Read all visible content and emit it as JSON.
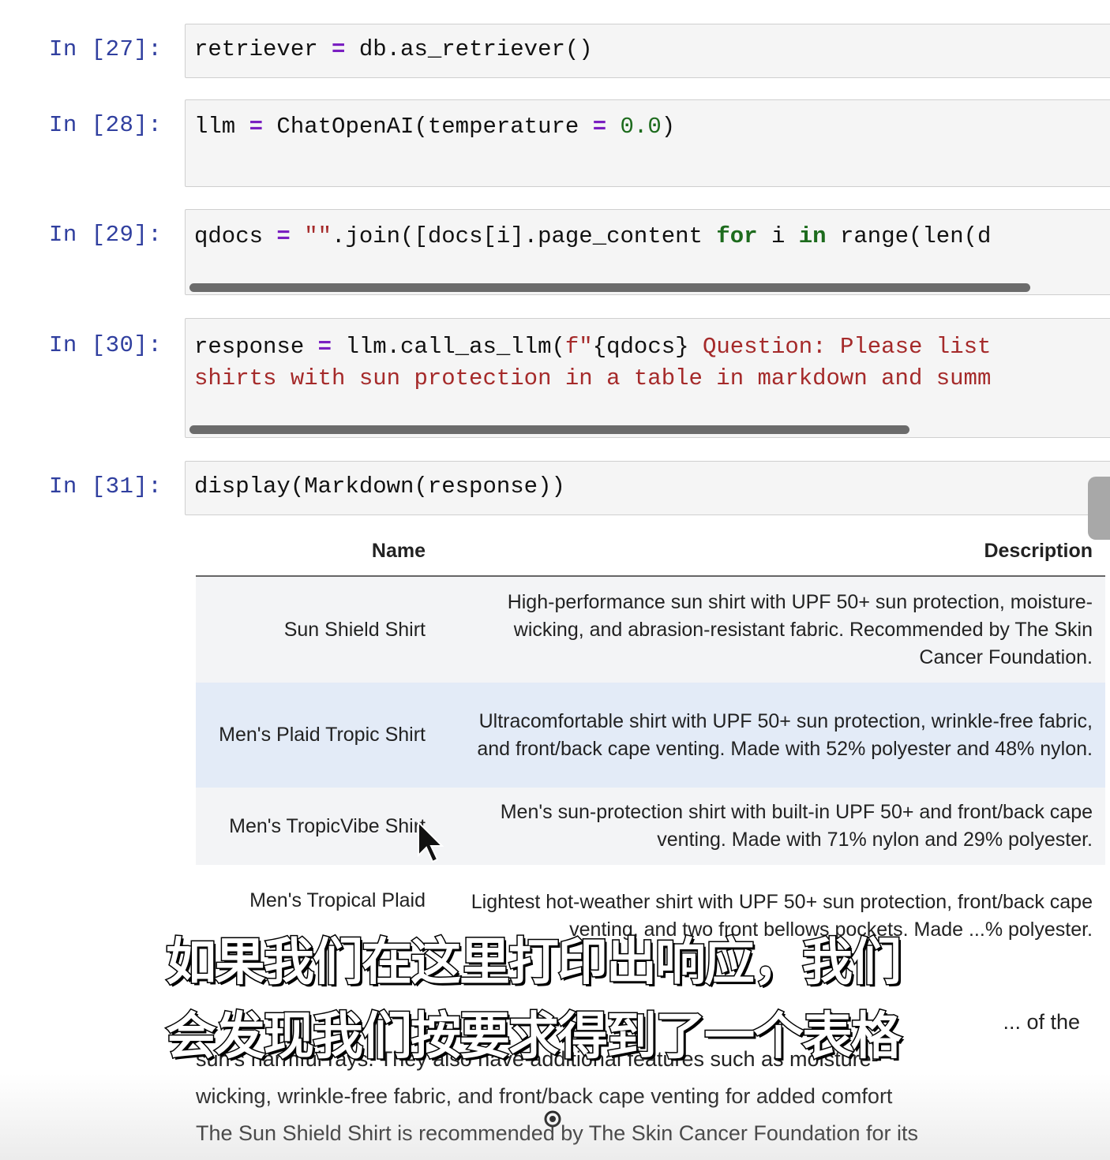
{
  "cells": [
    {
      "prompt": "In [27]:",
      "code": {
        "var": "retriever ",
        "op": "=",
        "rest": " db.as_retriever()"
      }
    },
    {
      "prompt": "In [28]:",
      "code": {
        "var": "llm ",
        "op": "=",
        "mid": " ChatOpenAI(temperature ",
        "op2": "=",
        "num": " 0.0",
        "tail": ")"
      }
    },
    {
      "prompt": "In [29]:",
      "code": {
        "var": "qdocs ",
        "op": "=",
        "str": " \"\"",
        "mid": ".join([docs[i].page_content ",
        "kw1": "for",
        "mid2": " i ",
        "kw2": "in",
        "tail": " range(len(d"
      },
      "scroll_fraction": 0.9
    },
    {
      "prompt": "In [30]:",
      "code": {
        "var": "response ",
        "op": "=",
        "mid": " llm.call_as_llm(",
        "str1": "f\"",
        "mid2": "{qdocs}",
        "str2": " Question: Please list",
        "line2": "shirts with sun protection in a table in markdown and summ"
      },
      "scroll_fraction": 0.77
    },
    {
      "prompt": "In [31]:",
      "code": {
        "text": "display(Markdown(response))"
      }
    }
  ],
  "output_table": {
    "headers": [
      "Name",
      "Description"
    ],
    "rows": [
      {
        "name": "Sun Shield Shirt",
        "description": "High-performance sun shirt with UPF 50+ sun protection, moisture-wicking, and abrasion-resistant fabric. Recommended by The Skin Cancer Foundation."
      },
      {
        "name": "Men's Plaid Tropic Shirt",
        "description": "Ultracomfortable shirt with UPF 50+ sun protection, wrinkle-free fabric, and front/back cape venting. Made with 52% polyester and 48% nylon."
      },
      {
        "name": "Men's TropicVibe Shirt",
        "description": "Men's sun-protection shirt with built-in UPF 50+ and front/back cape venting. Made with 71% nylon and 29% polyester."
      },
      {
        "name": "Men's Tropical Plaid",
        "description": "Lightest hot-weather shirt with UPF 50+ sun protection, front/back cape venting, and two front bellows pockets. Made ...% polyester."
      }
    ]
  },
  "summary_lines": [
    "... of the",
    "sun's harmful rays. They also have additional features such as moisture-",
    "wicking, wrinkle-free fabric, and front/back cape venting for added comfort",
    "The Sun Shield Shirt is recommended by The Skin Cancer Foundation for its"
  ],
  "subtitles": [
    "如果我们在这里打印出响应，我们",
    "会发现我们按要求得到了一个表格"
  ],
  "colors": {
    "prompt": "#303f9f",
    "operator": "#7a1fc1",
    "keyword": "#1d6b1d",
    "string": "#a52a2a",
    "cell_bg": "#f5f5f5",
    "highlight_row": "#e3ebf7"
  }
}
